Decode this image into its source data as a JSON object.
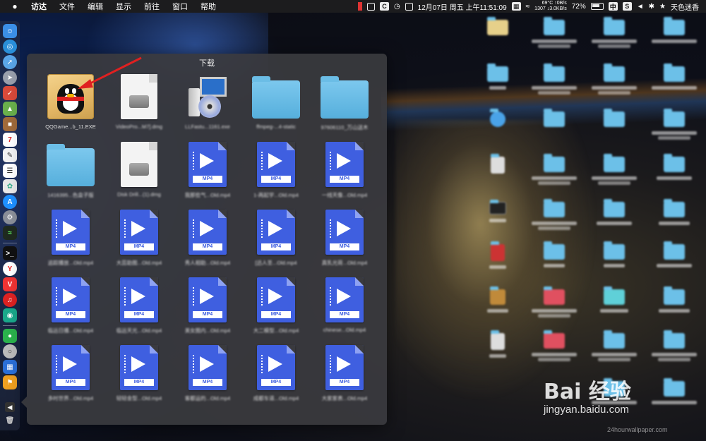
{
  "menubar": {
    "apple": "",
    "app_name": "访达",
    "menus": [
      "文件",
      "编辑",
      "显示",
      "前往",
      "窗口",
      "帮助"
    ],
    "status": {
      "datetime": "12月07日 周五 上午11:51:09",
      "temp": "69°C",
      "cpu": "1307",
      "net_up": "↑0B/s",
      "net_down": "↓3.0KB/s",
      "battery": "72%",
      "input_method": "中",
      "user": "天色迷香"
    }
  },
  "stack": {
    "title": "下载",
    "items": [
      {
        "type": "qq",
        "label": "QQGame...b_11.EXE"
      },
      {
        "type": "dmg",
        "label": "VideoPro...M7].dmg"
      },
      {
        "type": "installer",
        "label": "LLFastu...1161.exe"
      },
      {
        "type": "folder",
        "label": "ffmpeg-...4-static"
      },
      {
        "type": "folder",
        "label": "97606110_万山送木"
      },
      {
        "type": "folder",
        "label": "1416395...色盒子版"
      },
      {
        "type": "dmg",
        "label": "Disk Drill...(1).dmg"
      },
      {
        "type": "mp4",
        "label": "我那些气...Old.mp4"
      },
      {
        "type": "mp4",
        "label": "1-两起学...Old.mp4"
      },
      {
        "type": "mp4",
        "label": "一线天像...Old.mp4"
      },
      {
        "type": "mp4",
        "label": "追踪播放...Old.mp4"
      },
      {
        "type": "mp4",
        "label": "大蕊助图...Old.mp4"
      },
      {
        "type": "mp4",
        "label": "秀人相助...Old.mp4"
      },
      {
        "type": "mp4",
        "label": "[迅人圣...Old.mp4"
      },
      {
        "type": "mp4",
        "label": "真乳光荷...Old.mp4"
      },
      {
        "type": "mp4",
        "label": "临远日播...Old.mp4"
      },
      {
        "type": "mp4",
        "label": "临远天光...Old.mp4"
      },
      {
        "type": "mp4",
        "label": "美女图内...Old.mp4"
      },
      {
        "type": "mp4",
        "label": "大二模型...Old.mp4"
      },
      {
        "type": "mp4",
        "label": "chinese...Old.mp4"
      },
      {
        "type": "mp4",
        "label": "多时世界...Old.mp4"
      },
      {
        "type": "mp4",
        "label": "轻轻金型...Old.mp4"
      },
      {
        "type": "mp4",
        "label": "客都运的...Old.mp4"
      },
      {
        "type": "mp4",
        "label": "成都车道...Old.mp4"
      },
      {
        "type": "mp4",
        "label": "大家家表...Old.mp4"
      }
    ],
    "mp4_badge": "MP4"
  },
  "dock": {
    "icons": [
      "finder-icon",
      "safari-icon",
      "compass-icon",
      "launchpad-icon",
      "tasks-icon",
      "android-icon",
      "notes-icon",
      "calendar-icon",
      "textedit-icon",
      "document-icon",
      "photos-icon",
      "appstore-icon",
      "settings-icon",
      "monitor-icon",
      "terminal-icon",
      "yandex-icon",
      "vivaldi-icon",
      "netease-icon",
      "wechat-work-icon",
      "wechat-icon",
      "disk-icon",
      "windows-icon",
      "flag-icon"
    ]
  },
  "watermark": {
    "logo": "Bai 经验",
    "url": "jingyan.baidu.com",
    "site": "24hourwallpaper.com"
  },
  "colors": {
    "menubar_bg": "#1c1c1e",
    "stack_bg": "#3a3a3e",
    "folder": "#6cc0e8",
    "mp4": "#3f5fe0",
    "annotation": "#e02020"
  }
}
